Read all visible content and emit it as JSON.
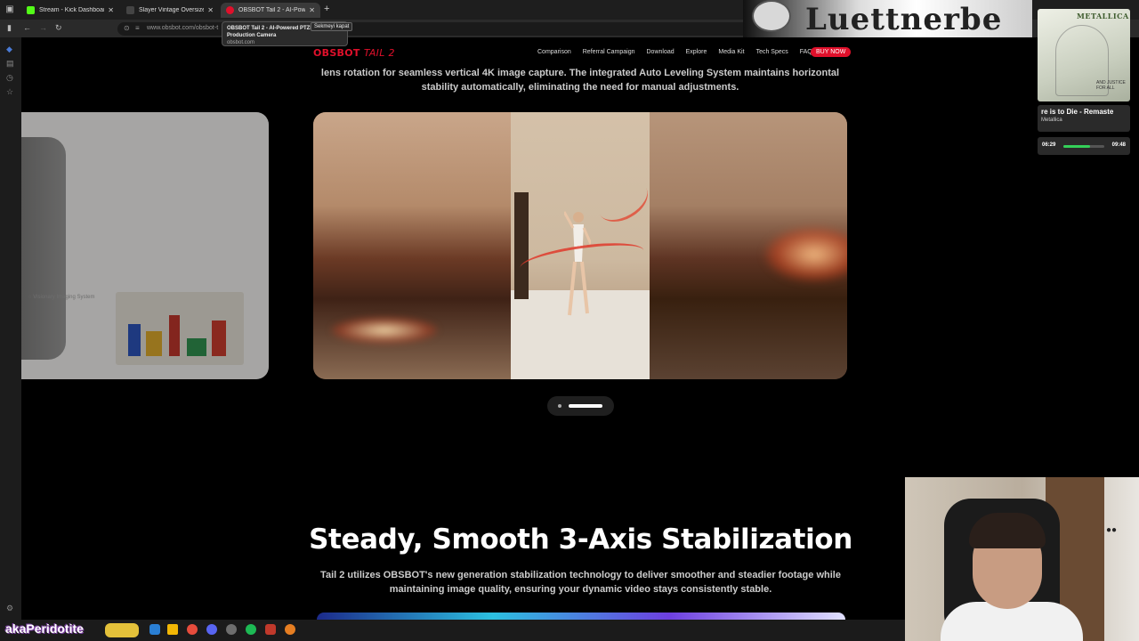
{
  "browser": {
    "tabs": [
      {
        "title": "Stream - Kick Dashboard",
        "favicon_color": "#53fc18",
        "active": false
      },
      {
        "title": "Slayer Vintage Oversize Siyah A",
        "favicon_color": "#444444",
        "active": false
      },
      {
        "title": "OBSBOT Tail 2 - AI-Powered P",
        "favicon_color": "#e0102b",
        "active": true
      }
    ],
    "new_tab": "+",
    "tooltip": {
      "title_line1": "OBSBOT Tail 2 - AI-Powered PTZR",
      "title_line2": "Production Camera",
      "domain": "obsbot.com"
    },
    "close_tab_tooltip": "Sekmeyi kapat",
    "url": "www.obsbot.com/obsbot-t"
  },
  "site": {
    "logo_main": "OBSBOT",
    "logo_sub": "TAIL 2",
    "nav": [
      "Comparison",
      "Referral Campaign",
      "Download",
      "Explore",
      "Media Kit",
      "Tech Specs",
      "FAQ"
    ],
    "buy_label": "BUY NOW",
    "accent_color": "#e0102b",
    "intro_text": "lens rotation for seamless vertical 4K image capture. The integrated Auto Leveling System maintains horizontal stability automatically, eliminating the need for manual adjustments.",
    "side_slide_label": "Visionary Imaging System",
    "carousel": {
      "active_index": 1,
      "dots": 2
    },
    "section_title": "Steady, Smooth 3-Axis Stabilization",
    "section_desc": "Tail 2 utilizes OBSBOT's new generation stabilization technology to deliver smoother and steadier footage while maintaining image quality, ensuring your dynamic video stays consistently stable."
  },
  "overlay": {
    "music": {
      "album_band": "METALLICA",
      "album_foot": "AND JUSTICE FOR ALL",
      "song": "re is to Die - Remaste",
      "artist": "Metallica",
      "elapsed": "06:29",
      "duration": "09:48",
      "progress": 0.66
    },
    "username": "akaPeridotite"
  },
  "icons": {
    "tab_menu": "tab-menu-icon",
    "back": "back-arrow-icon",
    "forward": "forward-arrow-icon",
    "reload": "reload-icon",
    "lock": "lock-icon",
    "translate": "translate-icon",
    "favorite": "star-icon"
  }
}
